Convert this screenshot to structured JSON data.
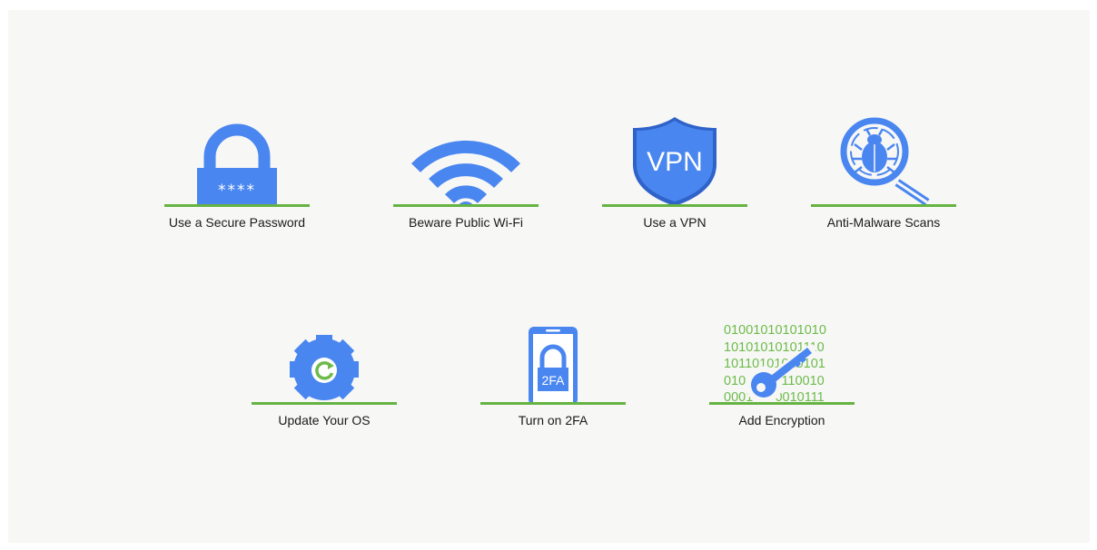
{
  "tips_row_1": [
    {
      "label": "Use a Secure Password",
      "icon": "padlock-password-icon"
    },
    {
      "label": "Beware Public Wi-Fi",
      "icon": "wifi-icon"
    },
    {
      "label": "Use a VPN",
      "icon": "vpn-shield-icon"
    },
    {
      "label": "Anti-Malware Scans",
      "icon": "bug-magnifier-icon"
    }
  ],
  "tips_row_2": [
    {
      "label": "Update Your OS",
      "icon": "gear-update-icon"
    },
    {
      "label": "Turn on 2FA",
      "icon": "phone-2fa-icon"
    },
    {
      "label": "Add Encryption",
      "icon": "key-binary-icon"
    }
  ],
  "icon_text": {
    "password_mask": "****",
    "vpn": "VPN",
    "twofa": "2FA",
    "binary_lines": [
      "01001010101010",
      "10101010101110",
      "10110101010101",
      "01010110110010",
      "00010100010111"
    ]
  },
  "colors": {
    "icon_blue": "#4a86f0",
    "icon_blue_dark": "#2f63c9",
    "baseline_green": "#65b443",
    "binary_green": "#6dbb4b",
    "panel_background": "#f7f7f5"
  }
}
